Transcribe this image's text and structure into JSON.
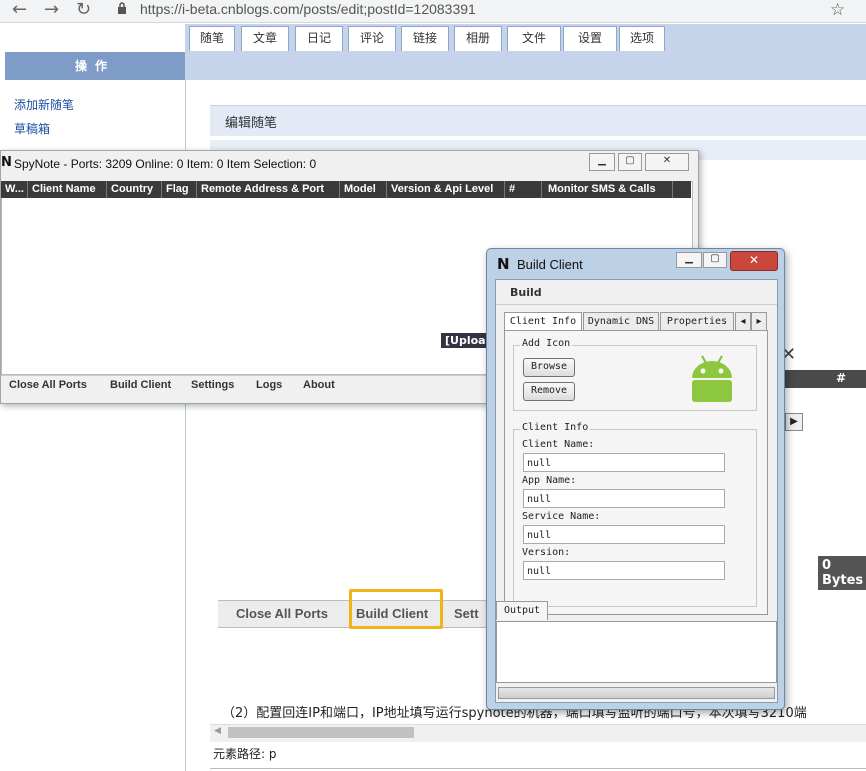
{
  "browser": {
    "url": "https://i-beta.cnblogs.com/posts/edit;postId=12083391",
    "back_icon": "arrow-left-icon",
    "forward_icon": "arrow-right-icon",
    "reload_icon": "reload-icon",
    "star_icon": "star-icon"
  },
  "admin": {
    "ops_header": "操作",
    "tabs": [
      "随笔",
      "文章",
      "日记",
      "评论",
      "链接",
      "相册",
      "文件",
      "设置",
      "选项"
    ],
    "side_links": [
      "添加新随笔",
      "草稿箱"
    ],
    "edit_title": "编辑随笔",
    "bg_buttons": [
      "Close All Ports",
      "Build Client",
      "Sett"
    ],
    "body_text": "（2）配置回连IP和端口，IP地址填写运行spynote的机器，端口填写监听的端口号，本次填写3210端",
    "element_path": "元素路径: p",
    "right_bytes": "0 Bytes",
    "right_hash": "#"
  },
  "spynote": {
    "title": "SpyNote - Ports: 3209 Online: 0 Item: 0 Item Selection: 0",
    "columns": [
      "W...",
      "Client Name",
      "Country",
      "Flag",
      "Remote Address & Port",
      "Model",
      "Version & Api Level",
      "#",
      "Monitor SMS & Calls"
    ],
    "upload_label": "[Upload",
    "menu": [
      "Close All Ports",
      "Build Client",
      "Settings",
      "Logs",
      "About"
    ]
  },
  "build_client": {
    "title": "Build Client",
    "build_label": "Build",
    "tabs": [
      "Client Info",
      "Dynamic DNS",
      "Properties"
    ],
    "add_icon_group": "Add Icon",
    "browse_label": "Browse",
    "remove_label": "Remove",
    "client_info_group": "Client Info",
    "fields": [
      {
        "label": "Client Name:",
        "value": "null"
      },
      {
        "label": "App Name:",
        "value": "null"
      },
      {
        "label": "Service Name:",
        "value": "null"
      },
      {
        "label": "Version:",
        "value": "null"
      }
    ],
    "output_tab": "Output"
  }
}
